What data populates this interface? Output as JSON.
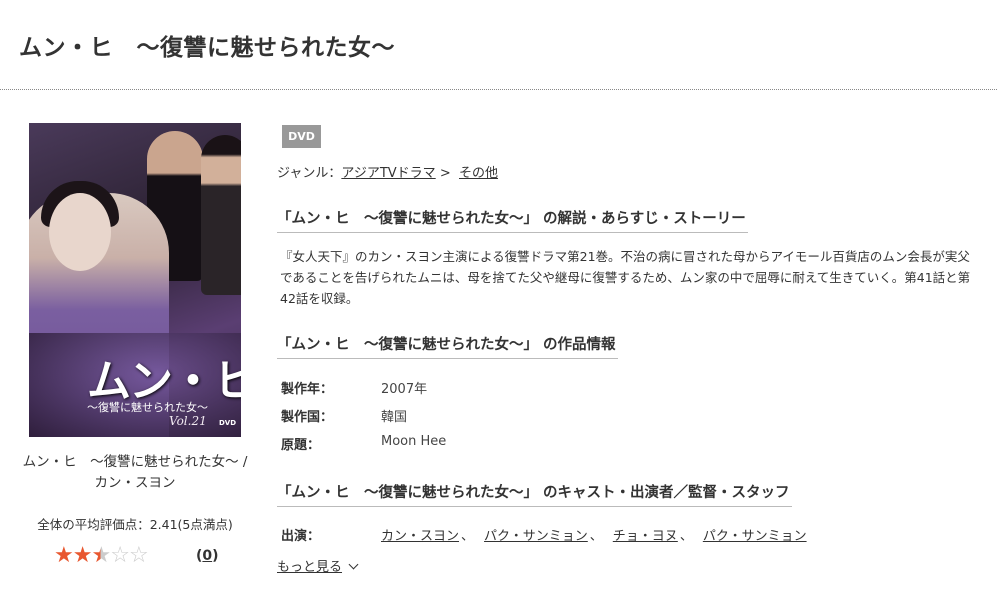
{
  "title": "ムン・ヒ　～復讐に魅せられた女～",
  "cover": {
    "title_text": "ムン・ヒ",
    "subtitle_text": "～復讐に魅せられた女～",
    "volume_text": "Vol.21",
    "media_text": "DVD"
  },
  "caption": "ムン・ヒ　～復讐に魅せられた女～ / カン・スヨン",
  "rating": {
    "label": "全体の平均評価点：2.41(5点満点)",
    "score": 2.41,
    "max": 5,
    "review_count": "0",
    "review_open": "(",
    "review_close": ")"
  },
  "badge": "DVD",
  "genre": {
    "label": "ジャンル：",
    "link1": "アジアTVドラマ",
    "separator": " > ",
    "link2": "その他"
  },
  "sections": {
    "story_heading": "「ムン・ヒ　～復讐に魅せられた女～」 の解説・あらすじ・ストーリー",
    "story_text": "『女人天下』のカン・スヨン主演による復讐ドラマ第21巻。不治の病に冒された母からアイモール百貨店のムン会長が実父であることを告げられたムニは、母を捨てた父や継母に復讐するため、ムン家の中で屈辱に耐えて生きていく。第41話と第42話を収録。",
    "info_heading": "「ムン・ヒ　～復讐に魅せられた女～」 の作品情報",
    "cast_heading": "「ムン・ヒ　～復讐に魅せられた女～」 のキャスト・出演者／監督・スタッフ"
  },
  "info": [
    {
      "label": "製作年：",
      "value": "2007年"
    },
    {
      "label": "製作国：",
      "value": "韓国"
    },
    {
      "label": "原題：",
      "value": "Moon Hee"
    }
  ],
  "cast": {
    "label": "出演：",
    "names": [
      "カン・スヨン",
      "パク・サンミョン",
      "チョ・ヨヌ",
      "パク・サンミョン"
    ],
    "separator": "、"
  },
  "more_label": "もっと見る",
  "colors": {
    "star": "#e8572f",
    "star_empty": "#cccccc",
    "badge_bg": "#999999"
  }
}
